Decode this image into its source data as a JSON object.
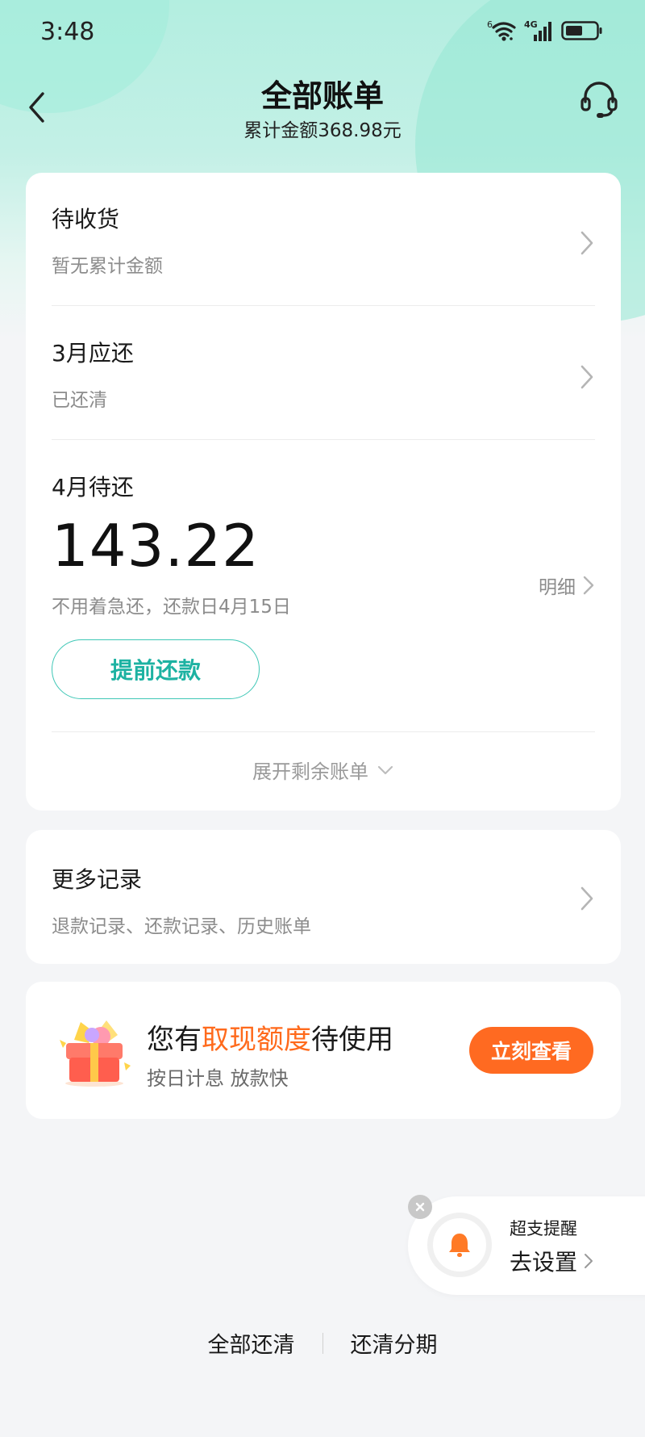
{
  "status_bar": {
    "time": "3:48",
    "wifi_badge": "6",
    "network_label": "4G"
  },
  "header": {
    "title": "全部账单",
    "subtitle": "累计金额368.98元"
  },
  "bills": {
    "pending_delivery": {
      "title": "待收货",
      "subtitle": "暂无累计金额"
    },
    "march": {
      "title": "3月应还",
      "subtitle": "已还清"
    },
    "april": {
      "title": "4月待还",
      "amount": "143.22",
      "note": "不用着急还，还款日4月15日",
      "detail_label": "明细",
      "prepay_label": "提前还款"
    },
    "expand_label": "展开剩余账单"
  },
  "more_records": {
    "title": "更多记录",
    "subtitle": "退款记录、还款记录、历史账单"
  },
  "promo": {
    "title_prefix": "您有",
    "title_highlight": "取现额度",
    "title_suffix": "待使用",
    "subtitle": "按日计息 放款快",
    "button_label": "立刻查看",
    "highlight_color": "#ff6a1c"
  },
  "reminder": {
    "title": "超支提醒",
    "action_label": "去设置"
  },
  "bottom_actions": {
    "pay_all": "全部还清",
    "installment": "还清分期"
  },
  "colors": {
    "accent": "#1db2a2",
    "orange": "#ff6a21"
  }
}
